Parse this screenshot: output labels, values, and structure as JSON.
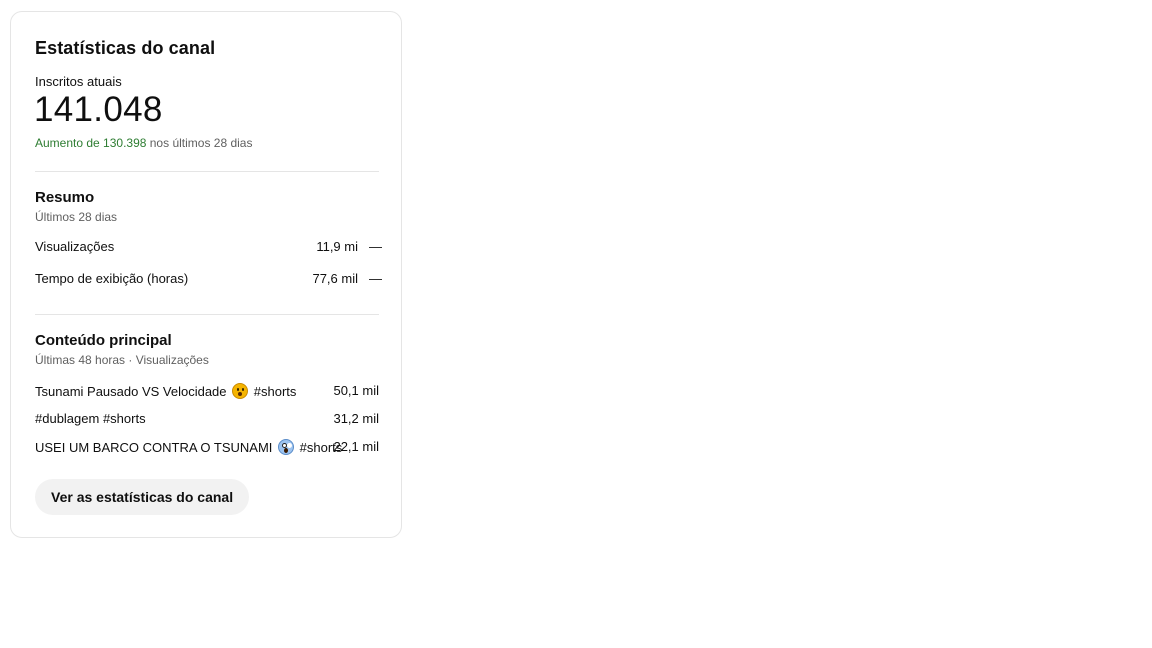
{
  "card": {
    "title": "Estatísticas do canal",
    "subscribers": {
      "label": "Inscritos atuais",
      "value": "141.048",
      "change_highlight": "Aumento de 130.398",
      "change_suffix": " nos últimos 28 dias",
      "change_color": "#2e7d32"
    },
    "summary": {
      "title": "Resumo",
      "subtitle": "Últimos 28 dias",
      "metrics": [
        {
          "label": "Visualizações",
          "value": "11,9 mi",
          "trend": "—"
        },
        {
          "label": "Tempo de exibição (horas)",
          "value": "77,6 mil",
          "trend": "—"
        }
      ]
    },
    "top_content": {
      "title": "Conteúdo principal",
      "subtitle": "Últimas 48 horas · Visualizações",
      "items": [
        {
          "label_before": "Tsunami Pausado VS Velocidade",
          "emoji": "surprised-face-icon",
          "label_after": "#shorts",
          "value": "50,1 mil"
        },
        {
          "label_before": "#dublagem #shorts",
          "emoji": null,
          "label_after": "",
          "value": "31,2 mil"
        },
        {
          "label_before": "USEI UM BARCO CONTRA O TSUNAMI",
          "emoji": "screaming-face-icon",
          "label_after": "#shorts",
          "value": "22,1 mil"
        }
      ]
    },
    "button_label": "Ver as estatísticas do canal"
  }
}
